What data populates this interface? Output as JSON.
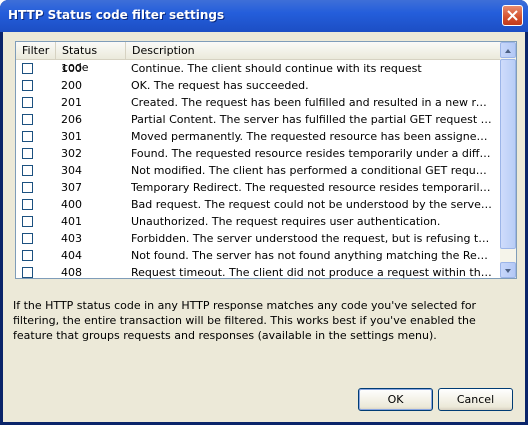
{
  "window": {
    "title": "HTTP Status code filter settings"
  },
  "list": {
    "columns": [
      "Filter",
      "Status code",
      "Description"
    ],
    "rows": [
      {
        "code": "100",
        "desc": "Continue. The client should continue with its request",
        "checked": false
      },
      {
        "code": "200",
        "desc": "OK. The request has succeeded.",
        "checked": false
      },
      {
        "code": "201",
        "desc": "Created. The request has been fulfilled and resulted in a new resource.",
        "checked": false
      },
      {
        "code": "206",
        "desc": "Partial Content. The server has fulfilled the partial GET request for the r...",
        "checked": false
      },
      {
        "code": "301",
        "desc": "Moved permanently. The requested resource has been assigned a new ...",
        "checked": false
      },
      {
        "code": "302",
        "desc": "Found. The requested resource resides temporarily under a different URI.",
        "checked": false
      },
      {
        "code": "304",
        "desc": "Not modified. The client has performed a conditional GET request and ac...",
        "checked": false
      },
      {
        "code": "307",
        "desc": "Temporary Redirect. The requested resource resides temporarily under ...",
        "checked": false
      },
      {
        "code": "400",
        "desc": "Bad request. The request could not be understood by the server due to...",
        "checked": false
      },
      {
        "code": "401",
        "desc": "Unauthorized. The request requires user authentication.",
        "checked": false
      },
      {
        "code": "403",
        "desc": "Forbidden. The server understood the request, but is refusing to fulfill it.",
        "checked": false
      },
      {
        "code": "404",
        "desc": "Not found. The server has not found anything matching the Request-U...",
        "checked": false
      },
      {
        "code": "408",
        "desc": "Request timeout. The client did not produce a request within the time th...",
        "checked": false
      }
    ]
  },
  "info": "If the HTTP status code in any HTTP response matches any code you've selected for filtering, the entire transaction will be filtered. This works best if you've enabled the feature that groups requests and responses (available in the settings menu).",
  "buttons": {
    "ok": "OK",
    "cancel": "Cancel"
  },
  "colors": {
    "titlebar": "#245edb",
    "client": "#ece9d8",
    "close": "#d4512e"
  }
}
